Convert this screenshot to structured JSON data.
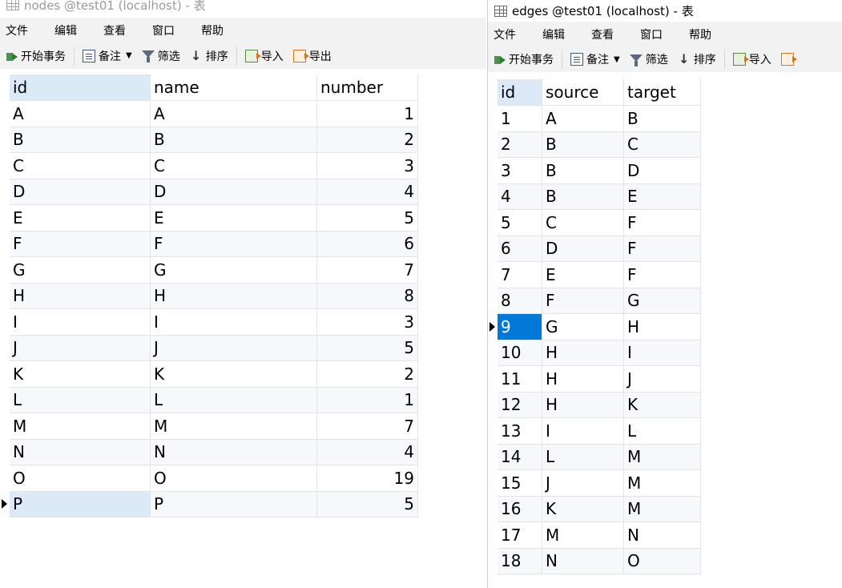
{
  "nodes_window": {
    "title": "nodes @test01 (localhost) - 表",
    "menu": [
      "文件",
      "编辑",
      "查看",
      "窗口",
      "帮助"
    ],
    "toolbar": {
      "begin_transaction": "开始事务",
      "memo": "备注",
      "filter": "筛选",
      "sort": "排序",
      "import": "导入",
      "export": "导出"
    },
    "columns": [
      "id",
      "name",
      "number"
    ],
    "rows": [
      [
        "A",
        "A",
        "1"
      ],
      [
        "B",
        "B",
        "2"
      ],
      [
        "C",
        "C",
        "3"
      ],
      [
        "D",
        "D",
        "4"
      ],
      [
        "E",
        "E",
        "5"
      ],
      [
        "F",
        "F",
        "6"
      ],
      [
        "G",
        "G",
        "7"
      ],
      [
        "H",
        "H",
        "8"
      ],
      [
        "I",
        "I",
        "3"
      ],
      [
        "J",
        "J",
        "5"
      ],
      [
        "K",
        "K",
        "2"
      ],
      [
        "L",
        "L",
        "1"
      ],
      [
        "M",
        "M",
        "7"
      ],
      [
        "N",
        "N",
        "4"
      ],
      [
        "O",
        "O",
        "19"
      ],
      [
        "P",
        "P",
        "5"
      ]
    ],
    "current_row": 15
  },
  "edges_window": {
    "title": "edges @test01 (localhost) - 表",
    "menu": [
      "文件",
      "编辑",
      "查看",
      "窗口",
      "帮助"
    ],
    "toolbar": {
      "begin_transaction": "开始事务",
      "memo": "备注",
      "filter": "筛选",
      "sort": "排序",
      "import": "导入"
    },
    "columns": [
      "id",
      "source",
      "target"
    ],
    "rows": [
      [
        "1",
        "A",
        "B"
      ],
      [
        "2",
        "B",
        "C"
      ],
      [
        "3",
        "B",
        "D"
      ],
      [
        "4",
        "B",
        "E"
      ],
      [
        "5",
        "C",
        "F"
      ],
      [
        "6",
        "D",
        "F"
      ],
      [
        "7",
        "E",
        "F"
      ],
      [
        "8",
        "F",
        "G"
      ],
      [
        "9",
        "G",
        "H"
      ],
      [
        "10",
        "H",
        "I"
      ],
      [
        "11",
        "H",
        "J"
      ],
      [
        "12",
        "H",
        "K"
      ],
      [
        "13",
        "I",
        "L"
      ],
      [
        "14",
        "L",
        "M"
      ],
      [
        "15",
        "J",
        "M"
      ],
      [
        "16",
        "K",
        "M"
      ],
      [
        "17",
        "M",
        "N"
      ],
      [
        "18",
        "N",
        "O"
      ]
    ],
    "current_row": 8
  },
  "colors": {
    "selected_cell": "#0078d7",
    "sorted_header": "#dce9f7",
    "toolbar_bg": "#f2f2f2"
  }
}
